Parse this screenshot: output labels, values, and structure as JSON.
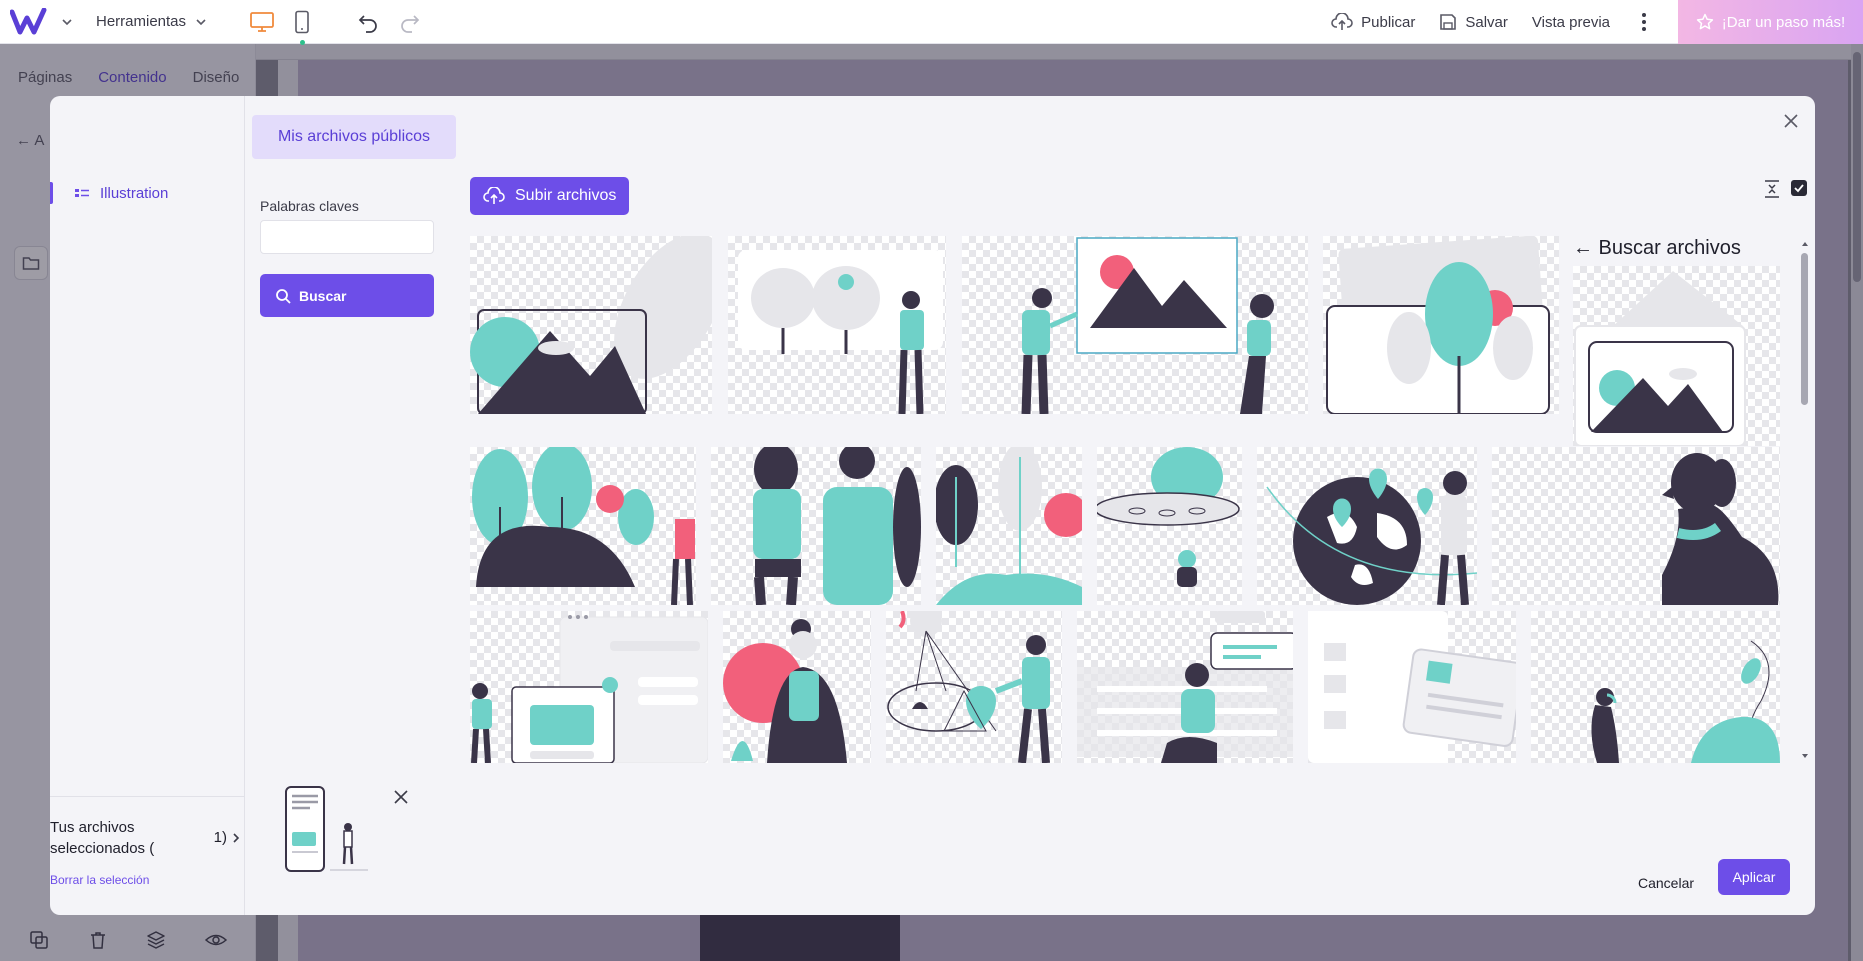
{
  "toolbar": {
    "tools_label": "Herramientas",
    "publish_label": "Publicar",
    "save_label": "Salvar",
    "preview_label": "Vista previa",
    "upgrade_label": "¡Dar un paso más!"
  },
  "left_panel": {
    "tabs": [
      {
        "label": "Páginas",
        "active": false
      },
      {
        "label": "Contenido",
        "active": true
      },
      {
        "label": "Diseño",
        "active": false
      }
    ],
    "back_label": "A"
  },
  "modal": {
    "categories": [
      {
        "label": "Illustration",
        "active": true
      }
    ],
    "source_tab": "Mis archivos públicos",
    "keywords_label": "Palabras claves",
    "keywords_value": "",
    "search_button": "Buscar",
    "upload_button": "Subir archivos",
    "search_hint": "← Buscar archivos",
    "selection": {
      "label": "Tus archivos seleccionados (",
      "count": "1)",
      "clear_label": "Borrar la selección"
    },
    "cancel_label": "Cancelar",
    "apply_label": "Aplicar",
    "gallery_count_visible": 18
  },
  "colors": {
    "accent": "#6d4ee8",
    "accent_light": "#e3dcfb",
    "illustration_teal": "#6fd1c8",
    "illustration_dark": "#3a3448",
    "illustration_pink": "#f2607b"
  },
  "icons": [
    "logo-icon",
    "chevron-down-icon",
    "desktop-icon",
    "mobile-icon",
    "undo-icon",
    "redo-icon",
    "upload-cloud-icon",
    "save-icon",
    "kebab-menu-icon",
    "star-icon",
    "close-icon",
    "search-icon",
    "list-icon",
    "folder-icon",
    "collapse-icon",
    "checkbox-icon",
    "chevron-right-icon",
    "copy-icon",
    "trash-icon",
    "layers-icon",
    "eye-icon"
  ]
}
